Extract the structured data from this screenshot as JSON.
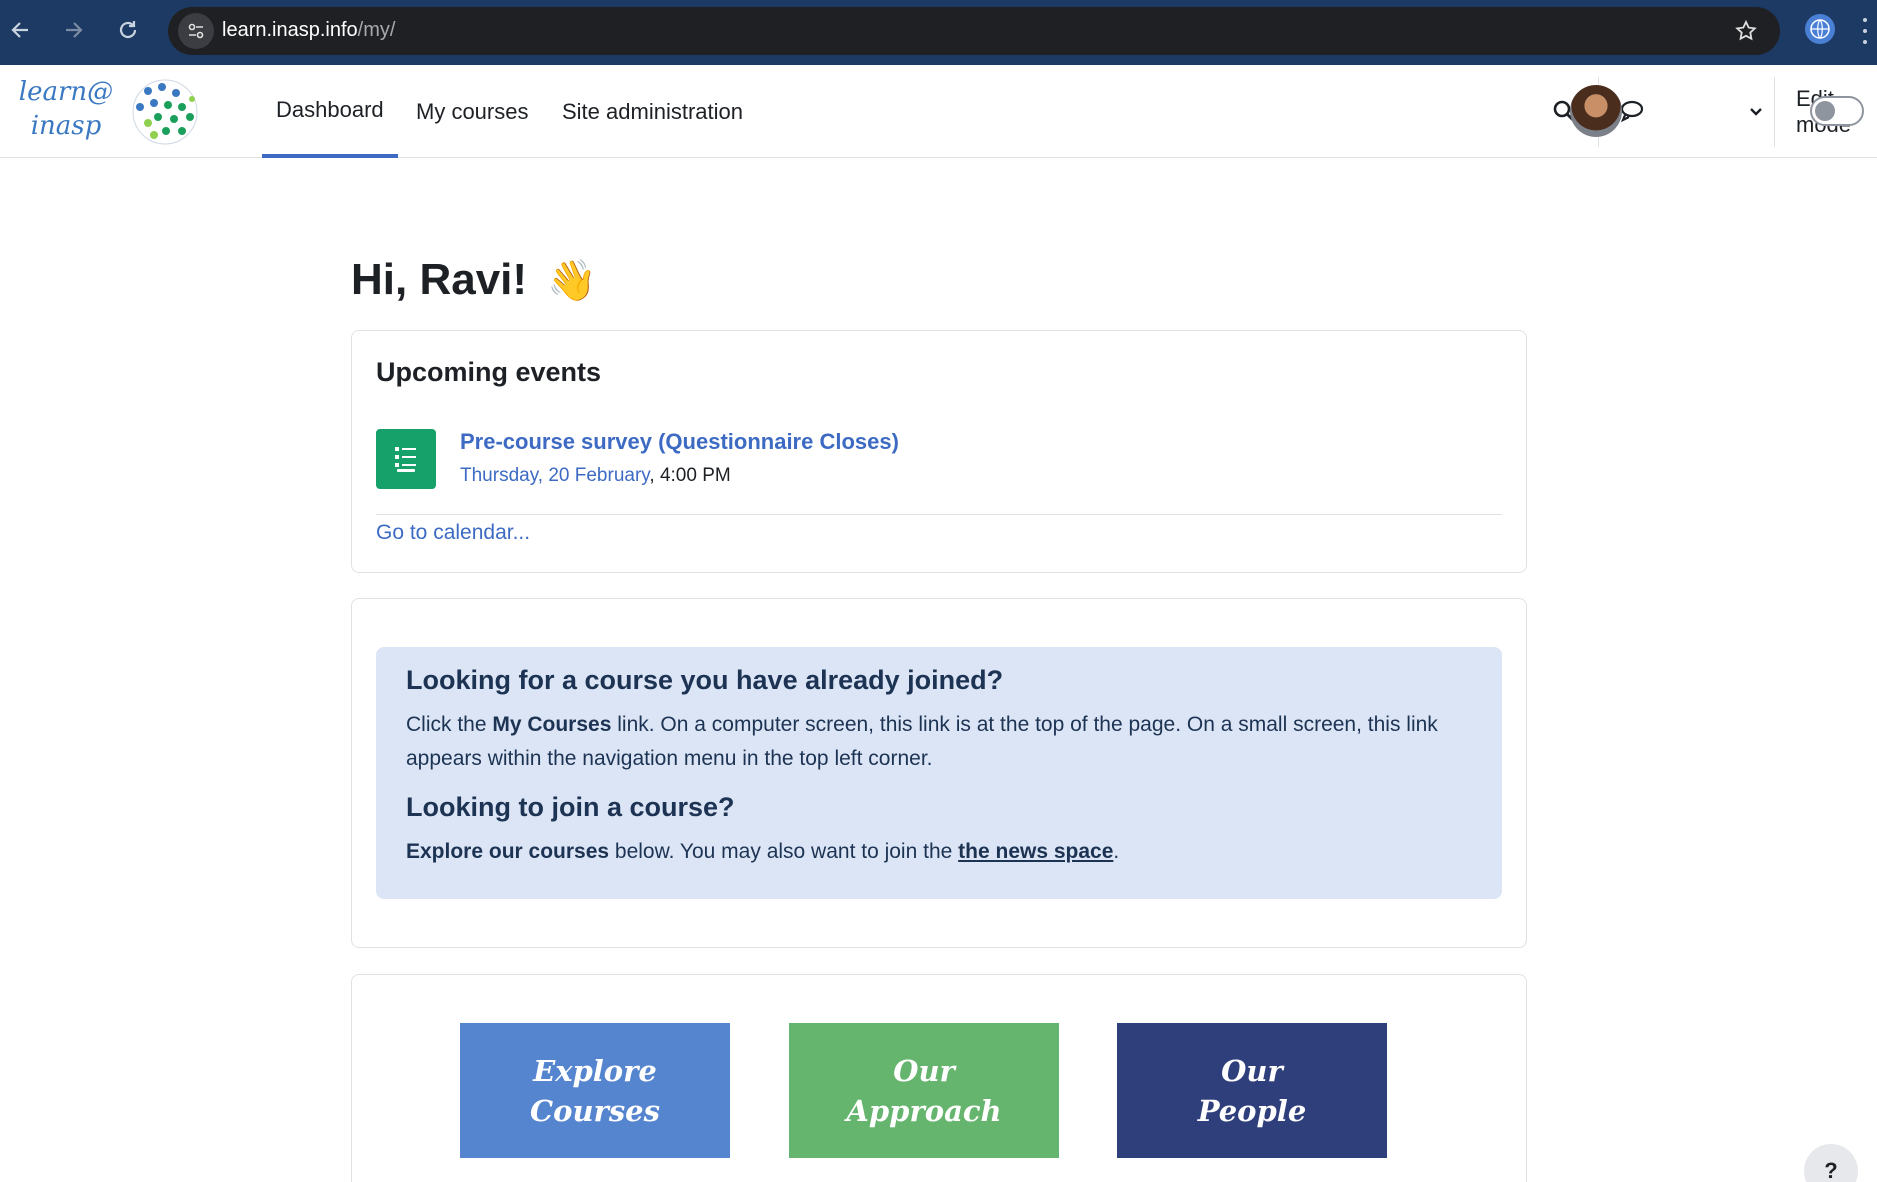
{
  "browser": {
    "url_host": "learn.inasp.info",
    "url_path": "/my/"
  },
  "site": {
    "logo_line1": "learn@",
    "logo_line2": "inasp",
    "nav": [
      {
        "label": "Dashboard",
        "active": true
      },
      {
        "label": "My courses",
        "active": false
      },
      {
        "label": "Site administration",
        "active": false
      }
    ],
    "edit_mode_label": "Edit mode",
    "edit_mode_on": false
  },
  "greeting": {
    "text": "Hi, Ravi!",
    "emoji": "👋"
  },
  "upcoming_events": {
    "title": "Upcoming events",
    "events": [
      {
        "title": "Pre-course survey (Questionnaire Closes)",
        "day": "Thursday, 20 February",
        "time": "4:00 PM",
        "icon": "questionnaire-icon"
      }
    ],
    "calendar_link": "Go to calendar..."
  },
  "info_box": {
    "heading1": "Looking for a course you have already joined?",
    "p1_before": "Click the ",
    "p1_bold": "My Courses",
    "p1_after": " link. On a computer screen, this link is at the top of the page. On a small screen, this link appears within the navigation menu in the top left corner.",
    "heading2": "Looking to join a course?",
    "p2_bold": "Explore our courses",
    "p2_mid": " below. You may also want to join the ",
    "p2_link": "the news space",
    "p2_end": "."
  },
  "tiles": [
    {
      "line1": "Explore",
      "line2": "Courses",
      "color": "#5585cf"
    },
    {
      "line1": "Our",
      "line2": "Approach",
      "color": "#65b56e"
    },
    {
      "line1": "Our",
      "line2": "People",
      "color": "#2f3f7c"
    }
  ],
  "help_label": "?",
  "colors": {
    "chrome_bg": "#1c3a63",
    "link_blue": "#3d6bc4",
    "info_bg": "#dbe5f5",
    "event_icon_bg": "#16a06a"
  }
}
